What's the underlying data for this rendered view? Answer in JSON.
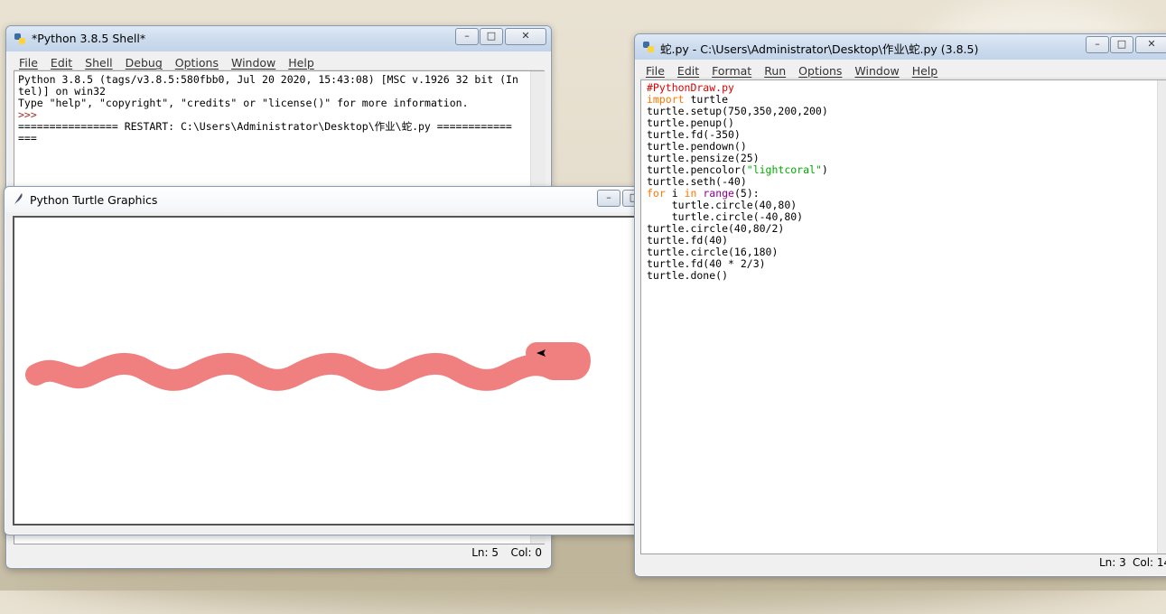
{
  "shell": {
    "title": "*Python 3.8.5 Shell*",
    "menus": [
      "File",
      "Edit",
      "Shell",
      "Debug",
      "Options",
      "Window",
      "Help"
    ],
    "lines": [
      "Python 3.8.5 (tags/v3.8.5:580fbb0, Jul 20 2020, 15:43:08) [MSC v.1926 32 bit (In",
      "tel)] on win32",
      "Type \"help\", \"copyright\", \"credits\" or \"license()\" for more information.",
      ">>> ",
      "================ RESTART: C:\\Users\\Administrator\\Desktop\\作业\\蛇.py ============",
      "==="
    ],
    "status_ln": "Ln: 5",
    "status_col": "Col: 0"
  },
  "turtle": {
    "title": "Python Turtle Graphics",
    "pencolor": "#f08080"
  },
  "editor": {
    "title": "蛇.py - C:\\Users\\Administrator\\Desktop\\作业\\蛇.py (3.8.5)",
    "menus": [
      "File",
      "Edit",
      "Format",
      "Run",
      "Options",
      "Window",
      "Help"
    ],
    "code": [
      "#PythonDraw.py",
      "import turtle",
      "turtle.setup(750,350,200,200)",
      "turtle.penup()",
      "turtle.fd(-350)",
      "turtle.pendown()",
      "turtle.pensize(25)",
      "turtle.pencolor(\"lightcoral\")",
      "turtle.seth(-40)",
      "for i in range(5):",
      "    turtle.circle(40,80)",
      "    turtle.circle(-40,80)",
      "turtle.circle(40,80/2)",
      "turtle.fd(40)",
      "turtle.circle(16,180)",
      "turtle.fd(40 * 2/3)",
      "turtle.done()"
    ],
    "status_ln": "Ln: 3",
    "status_col": "Col: 14"
  },
  "window_controls": {
    "minimize": "–",
    "maximize": "□",
    "close": "✕"
  }
}
